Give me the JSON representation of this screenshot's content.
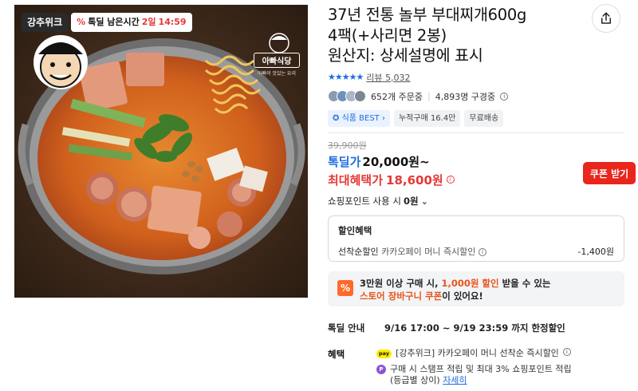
{
  "image": {
    "store_badge": "강추위크",
    "timer_icon": "%",
    "timer_label": "톡딜 남은시간",
    "timer_days": "2일",
    "timer_time": "14:59",
    "brand_name": "아빠식당",
    "brand_sub": "아빠의 맛있는 요리"
  },
  "product": {
    "title_line1": "37년 전통 놀부 부대찌개600g",
    "title_line2": "4팩(+사리면 2봉)",
    "title_line3": "원산지: 상세설명에 표시",
    "share_icon": "share-icon"
  },
  "rating": {
    "stars": "★★★★★",
    "review_label": "리뷰",
    "review_count": "5,032"
  },
  "social": {
    "orders": "652개 주문중",
    "subscribers": "4,893명 구경중",
    "info_icon": "i"
  },
  "tags": {
    "best": "식품 BEST",
    "cumulative": "누적구매 16.4만",
    "shipping": "무료배송"
  },
  "price": {
    "original": "39,900원",
    "deal_label": "톡딜가",
    "deal_value": "20,000원~",
    "max_benefit_label": "최대혜택가",
    "max_benefit_value": "18,600원",
    "coupon_button": "쿠폰 받기",
    "points_label": "쇼핑포인트 사용 시",
    "points_value": "0원"
  },
  "discount": {
    "heading": "할인혜택",
    "item_label": "선착순할인",
    "item_desc": "카카오페이 머니 즉시할인",
    "item_value": "-1,400원"
  },
  "store_coupon": {
    "line1_a": "3만원 이상 구매 시, ",
    "line1_hl": "1,000원 할인",
    "line1_b": " 받을 수 있는",
    "line2_hl": "스토어 장바구니 쿠폰",
    "line2_b": "이 있어요!"
  },
  "deal": {
    "label": "톡딜 안내",
    "value": "9/16 17:00 ~ 9/19 23:59 까지 한정할인"
  },
  "perks": {
    "label": "혜택",
    "item1": "[강추위크] 카카오페이 머니 선착순 즉시할인",
    "item2": "구매 시 스탬프 적립 및 최대 3% 쇼핑포인트 적립",
    "item2b": "(등급별 상이)",
    "item2_link": "자세히",
    "pay_icon": "pay",
    "p_icon": "P"
  }
}
